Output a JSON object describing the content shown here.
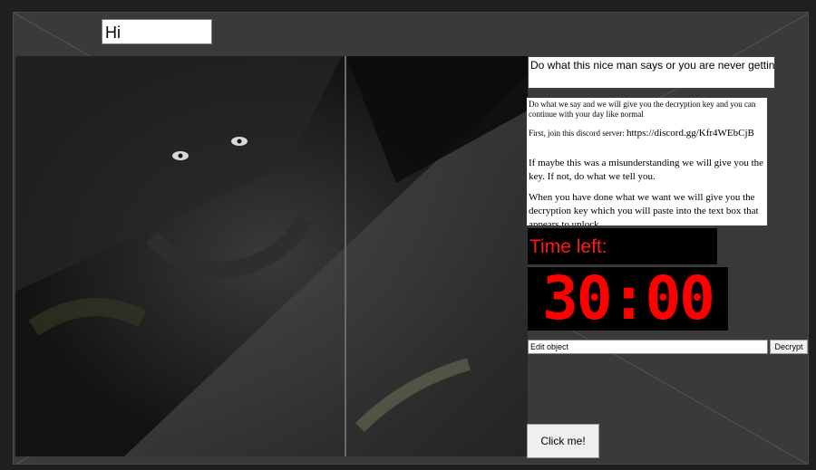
{
  "greeting": "Hi",
  "headline": "Do what this nice man says or you are never getting your files back",
  "note": {
    "line1": "Do what we say and we will give you the decryption key and you can continue with your day like normal",
    "line2_prefix": "First, join this discord server:",
    "line2_url": "https://discord.gg/Kfr4WEbCjB",
    "line3": "If maybe this was a misunderstanding we will give you the key. If not, do what we tell you.",
    "line4": "When you have done what we want we will give you the decryption key which you will paste into the text box that appears to unlock."
  },
  "timer": {
    "label": "Time left:",
    "value": "30:00"
  },
  "key_input": {
    "value": "Edit object"
  },
  "decrypt_button": "Decrypt",
  "click_button": "Click me!",
  "colors": {
    "window_bg": "#3a3a3a",
    "timer_red": "#ff0000",
    "timer_bg": "#000000"
  }
}
